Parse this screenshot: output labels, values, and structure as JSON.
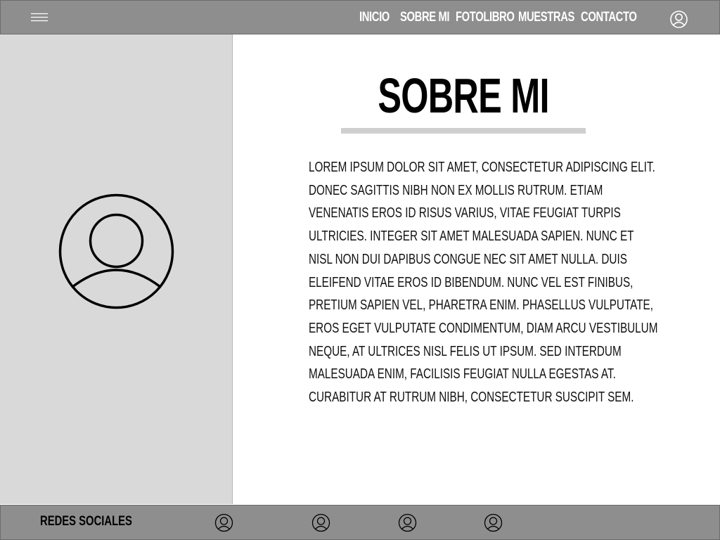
{
  "header": {
    "nav": [
      {
        "label": "INICIO"
      },
      {
        "label": "SOBRE MI"
      },
      {
        "label": "FOTOLIBRO"
      },
      {
        "label": "MUESTRAS"
      },
      {
        "label": "CONTACTO"
      }
    ],
    "menu_icon": "hamburger-icon",
    "user_icon": "user-icon"
  },
  "main": {
    "title": "SOBRE MI",
    "avatar_icon": "user-icon",
    "paragraph_lines": [
      "LOREM IPSUM DOLOR SIT AMET, CONSECTETUR ADIPISCING ELIT.",
      "DONEC SAGITTIS NIBH NON EX MOLLIS RUTRUM. ETIAM",
      "VENENATIS EROS ID RISUS VARIUS, VITAE FEUGIAT TURPIS",
      "ULTRICIES. INTEGER SIT AMET MALESUADA SAPIEN. NUNC ET",
      "NISL NON DUI DAPIBUS CONGUE NEC SIT AMET NULLA. DUIS",
      "ELEIFEND VITAE EROS ID BIBENDUM. NUNC VEL EST FINIBUS,",
      "PRETIUM SAPIEN VEL, PHARETRA ENIM. PHASELLUS VULPUTATE,",
      "EROS EGET VULPUTATE CONDIMENTUM, DIAM ARCU VESTIBULUM",
      "NEQUE, AT ULTRICES NISL FELIS UT IPSUM. SED INTERDUM",
      "MALESUADA ENIM, FACILISIS FEUGIAT NULLA EGESTAS AT.",
      "CURABITUR AT RUTRUM NIBH, CONSECTETUR SUSCIPIT SEM."
    ]
  },
  "footer": {
    "label": "REDES SOCIALES",
    "social_icons": [
      "user-icon",
      "user-icon",
      "user-icon",
      "user-icon"
    ]
  },
  "colors": {
    "bar": "#8e8e8e",
    "panel": "#d9d9d9",
    "rule": "#cfcfcf",
    "text": "#000000"
  }
}
